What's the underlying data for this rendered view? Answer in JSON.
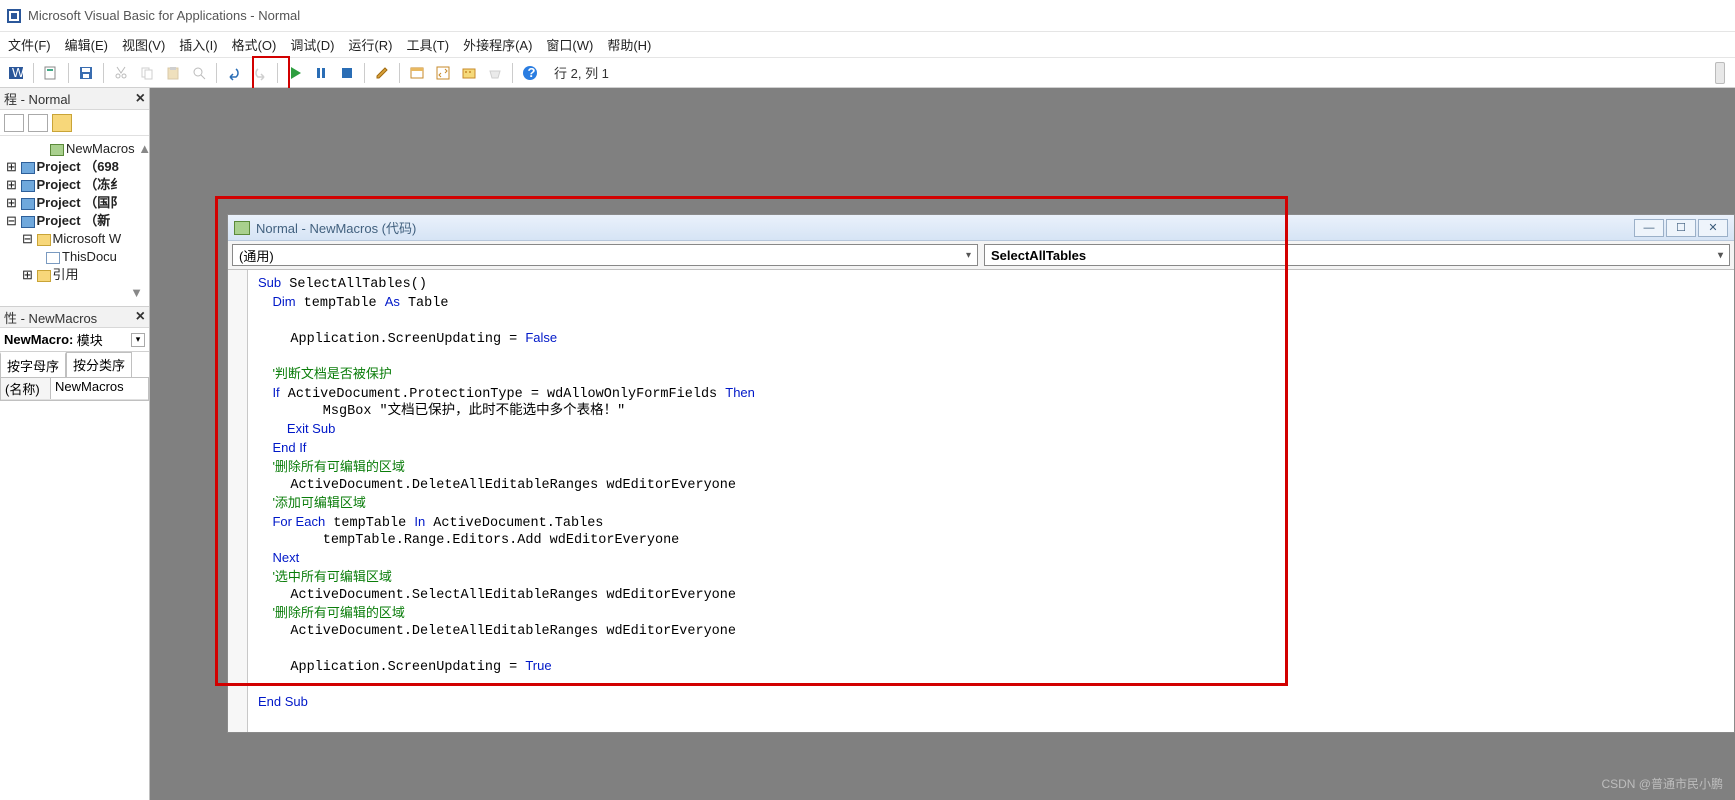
{
  "title": "Microsoft Visual Basic for Applications - Normal",
  "menu": [
    "文件(F)",
    "编辑(E)",
    "视图(V)",
    "插入(I)",
    "格式(O)",
    "调试(D)",
    "运行(R)",
    "工具(T)",
    "外接程序(A)",
    "窗口(W)",
    "帮助(H)"
  ],
  "cursor_pos": "行 2, 列 1",
  "project_panel_title": "程 - Normal",
  "props_panel_title": "性 - NewMacros",
  "props_sub_name": "NewMacro:",
  "props_sub_type": "模块",
  "props_tabs": [
    "按字母序",
    "按分类序"
  ],
  "props_row_key": "(名称)",
  "props_row_val": "NewMacros",
  "tree": {
    "newmacros": "NewMacros",
    "p1": "Project （698",
    "p2": "Project （冻纟",
    "p3": "Project （国阝",
    "p4": "Project （新",
    "msword": "Microsoft W",
    "thisdoc": "ThisDocu",
    "ref": "引用"
  },
  "codewin_title": "Normal - NewMacros (代码)",
  "combo_left": "(通用)",
  "combo_right": "SelectAllTables",
  "code": {
    "l1a": "Sub",
    "l1b": " SelectAllTables()",
    "l2a": "    Dim",
    "l2b": " tempTable ",
    "l2c": "As",
    "l2d": " Table",
    "l3": "",
    "l4a": "    Application.ScreenUpdating = ",
    "l4b": "False",
    "l5": "",
    "l6": "    '判断文档是否被保护",
    "l7a": "    If",
    "l7b": " ActiveDocument.ProtectionType = wdAllowOnlyFormFields ",
    "l7c": "Then",
    "l8": "        MsgBox \"文档已保护，此时不能选中多个表格！\"",
    "l9": "        Exit Sub",
    "l10": "    End If",
    "l11": "    '删除所有可编辑的区域",
    "l12": "    ActiveDocument.DeleteAllEditableRanges wdEditorEveryone",
    "l13": "    '添加可编辑区域",
    "l14a": "    For Each",
    "l14b": " tempTable ",
    "l14c": "In",
    "l14d": " ActiveDocument.Tables",
    "l15": "        tempTable.Range.Editors.Add wdEditorEveryone",
    "l16": "    Next",
    "l17": "    '选中所有可编辑区域",
    "l18": "    ActiveDocument.SelectAllEditableRanges wdEditorEveryone",
    "l19": "    '删除所有可编辑的区域",
    "l20": "    ActiveDocument.DeleteAllEditableRanges wdEditorEveryone",
    "l21": "",
    "l22a": "    Application.ScreenUpdating = ",
    "l22b": "True",
    "l23": "",
    "l24": "End Sub"
  },
  "watermark": "CSDN @普通市民小鹏"
}
